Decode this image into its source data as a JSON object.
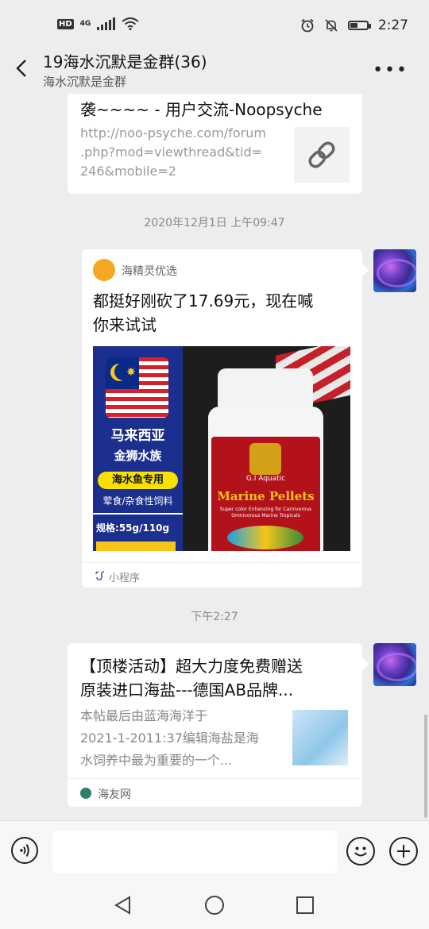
{
  "status_bar": {
    "hd": "HD",
    "network": "4G",
    "time": "2:27",
    "battery_level": 0.45
  },
  "header": {
    "title": "19海水沉默是金群(36)",
    "subtitle": "海水沉默是金群",
    "back_icon": "chevron-left-icon",
    "more_icon": "more-icon"
  },
  "messages": [
    {
      "type": "link",
      "title_tail": "袭~~~~ - 用户交流-Noopsyche",
      "url": "http://noo-psyche.com/forum.php?mod=viewthread&tid=246&mobile=2",
      "url_lines": [
        "http://noo-psyche.com/forum",
        ".php?mod=viewthread&tid=",
        "246&mobile=2"
      ],
      "thumb_icon": "link-icon"
    },
    {
      "type": "timestamp",
      "text": "2020年12月1日 上午09:47"
    },
    {
      "type": "mini_program",
      "source": "海精灵优选",
      "title_lines": [
        "都挺好刚砍了17.69元，现在喊",
        "你来试试"
      ],
      "footer": "小程序",
      "product": {
        "brand_lines": [
          "马来西亚",
          "金狮水族"
        ],
        "tag": "海水鱼专用",
        "feed": "荤食/杂食性饲料",
        "spec": "规格:55g/110g",
        "bottle_label": "Marine Pellets",
        "bottle_brand": "G.I Aquatic",
        "bottle_sub": "Super color Enhancing for Carnivorous Omnivorous Marine Tropicals"
      }
    },
    {
      "type": "timestamp",
      "text": "下午2:27"
    },
    {
      "type": "link_card",
      "title_lines": [
        "【顶楼活动】超大力度免费赠送",
        "原装进口海盐---德国AB品牌..."
      ],
      "desc_lines": [
        "本帖最后由蓝海海洋于",
        "2021-1-2011:37编辑海盐是海",
        "水饲养中最为重要的一个..."
      ],
      "source": "海友网"
    }
  ],
  "input_bar": {
    "voice_icon": "voice-icon",
    "emoji_icon": "emoji-icon",
    "plus_icon": "plus-icon",
    "placeholder": ""
  },
  "nav": {
    "back_icon": "triangle-back-icon",
    "home_icon": "circle-home-icon",
    "recent_icon": "square-recent-icon"
  }
}
